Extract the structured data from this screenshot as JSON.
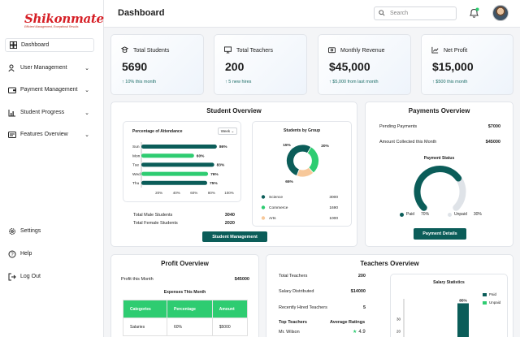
{
  "brand": {
    "name": "Shikonmate",
    "tagline": "Efficient Management, Exceptional Results"
  },
  "sidebar": {
    "items": [
      {
        "label": "Dashboard",
        "icon": "dashboard-icon"
      },
      {
        "label": "User Management",
        "icon": "users-icon"
      },
      {
        "label": "Payment Management",
        "icon": "wallet-icon"
      },
      {
        "label": "Student Progress",
        "icon": "bar-chart-icon"
      },
      {
        "label": "Features Overview",
        "icon": "features-icon"
      }
    ],
    "bottom": [
      {
        "label": "Settings",
        "icon": "gear-icon"
      },
      {
        "label": "Help",
        "icon": "help-icon"
      },
      {
        "label": "Log Out",
        "icon": "logout-icon"
      }
    ]
  },
  "header": {
    "title": "Dashboard",
    "search_placeholder": "Search"
  },
  "stats": [
    {
      "label": "Total Students",
      "value": "5690",
      "sub": "↑ 10% this month"
    },
    {
      "label": "Total Teachers",
      "value": "200",
      "sub": "↑ 5 new hires"
    },
    {
      "label": "Monthly Revenue",
      "value": "$45,000",
      "sub": "↑ $5,000 from last month"
    },
    {
      "label": "Net Profit",
      "value": "$15,000",
      "sub": "↑ $500 this month"
    }
  ],
  "student_overview": {
    "title": "Student Overview",
    "attendance_title": "Percentage of Attendance",
    "period": "Week",
    "group_title": "Students by Group",
    "totals": [
      {
        "label": "Total Male Students",
        "value": "3040"
      },
      {
        "label": "Total Female Students",
        "value": "2020"
      }
    ],
    "button": "Student Management"
  },
  "payments_overview": {
    "title": "Payments Overview",
    "rows": [
      {
        "label": "Pending Payments",
        "value": "$7000"
      },
      {
        "label": "Amount Collected this Month",
        "value": "$45000"
      }
    ],
    "status_title": "Payment Status",
    "legend": [
      {
        "label": "Paid",
        "pct": "70%"
      },
      {
        "label": "Unpaid",
        "pct": "30%"
      }
    ],
    "paid_fraction": 0.7,
    "button": "Payment Details"
  },
  "profit_overview": {
    "title": "Profit Overview",
    "profit_label": "Profit this Month",
    "profit_value": "$45000",
    "table_title": "Expenses This Month",
    "columns": [
      "Categories",
      "Percentage",
      "Amount"
    ],
    "rows": [
      [
        "Salaries",
        "60%",
        "$5000"
      ]
    ]
  },
  "teachers_overview": {
    "title": "Teachers Overview",
    "rows": [
      {
        "label": "Total Teachers",
        "value": "200"
      },
      {
        "label": "Salary Distributed",
        "value": "$14000"
      },
      {
        "label": "Recently Hired Teachers",
        "value": "5"
      }
    ],
    "top_label": "Top Teachers",
    "rating_label": "Average Ratings",
    "top": [
      {
        "name": "Mr. Wilson",
        "rating": "4.9"
      }
    ],
    "salary_title": "Salary Statistics",
    "salary_legend": [
      "Paid",
      "Unpaid"
    ]
  },
  "colors": {
    "teal": "#0b5d59",
    "green": "#2ecc71",
    "peach": "#f7c89a",
    "light": "#dfe3e8"
  },
  "chart_data": [
    {
      "type": "bar",
      "orientation": "horizontal",
      "title": "Percentage of Attendance",
      "categories": [
        "Sun",
        "Mon",
        "Tue",
        "Wed",
        "Thu"
      ],
      "values": [
        86,
        60,
        83,
        76,
        75
      ],
      "value_labels": [
        "86%",
        "60%",
        "83%",
        "76%",
        "75%"
      ],
      "xticks": [
        "20%",
        "40%",
        "60%",
        "80%",
        "100%"
      ],
      "xlim": [
        0,
        100
      ]
    },
    {
      "type": "pie",
      "title": "Students by Group",
      "labels": [
        "Science",
        "Commerce",
        "Arts"
      ],
      "values": [
        3000,
        1690,
        1000
      ],
      "percent_labels": [
        "65%",
        "20%",
        "15%"
      ],
      "colors": [
        "#0b5d59",
        "#2ecc71",
        "#f7c89a"
      ]
    },
    {
      "type": "bar",
      "title": "Salary Statistics",
      "yticks": [
        "30",
        "20",
        "10"
      ],
      "series": [
        {
          "name": "Paid",
          "values": [
            85
          ]
        }
      ],
      "value_labels": [
        "85%"
      ]
    }
  ]
}
